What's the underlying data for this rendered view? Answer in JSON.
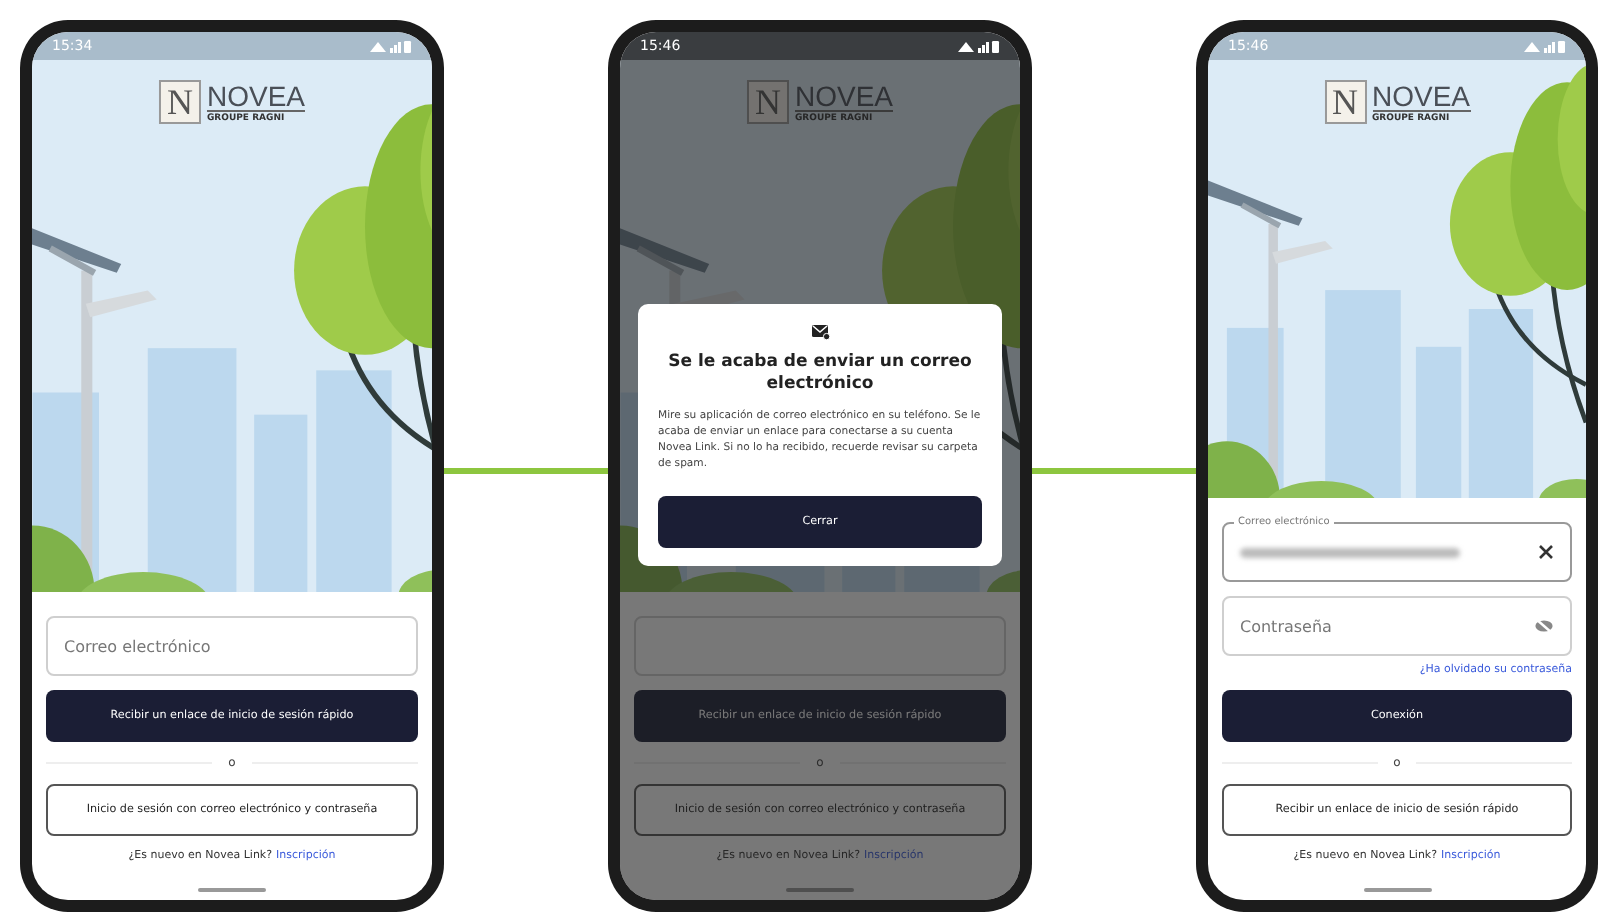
{
  "screens": [
    {
      "kind": "quick_link",
      "time": "15:34",
      "logo": {
        "mark": "N",
        "name": "NOVEA",
        "group": "GROUPE RAGNI"
      },
      "email_field": {
        "placeholder": "Correo electrónico"
      },
      "primary_button": "Recibir un enlace de inicio de sesión rápido",
      "separator": "o",
      "secondary_button": "Inicio de sesión con correo electrónico y contraseña",
      "signup": {
        "prompt": "¿Es nuevo en Novea Link?",
        "link": "Inscripción"
      }
    },
    {
      "kind": "quick_link",
      "time": "15:46",
      "logo": {
        "mark": "N",
        "name": "NOVEA",
        "group": "GROUPE RAGNI"
      },
      "primary_button": "Recibir un enlace de inicio de sesión rápido",
      "separator": "o",
      "secondary_button": "Inicio de sesión con correo electrónico y contraseña",
      "signup": {
        "prompt": "¿Es nuevo en Novea Link?",
        "link": "Inscripción"
      },
      "dialog": {
        "title": "Se le acaba de enviar un correo electrónico",
        "body": "Mire su aplicación de correo electrónico en su teléfono. Se le acaba de enviar un enlace para conectarse a su cuenta Novea Link. Si no lo ha recibido, recuerde revisar su carpeta de spam.",
        "button": "Cerrar"
      }
    },
    {
      "kind": "password",
      "time": "15:46",
      "logo": {
        "mark": "N",
        "name": "NOVEA",
        "group": "GROUPE RAGNI"
      },
      "email_field": {
        "label": "Correo electrónico"
      },
      "password_field": {
        "placeholder": "Contraseña"
      },
      "forgot_link": "¿Ha olvidado su contraseña",
      "primary_button": "Conexión",
      "separator": "o",
      "secondary_button": "Recibir un enlace de inicio de sesión rápido",
      "signup": {
        "prompt": "¿Es nuevo en Novea Link?",
        "link": "Inscripción"
      }
    }
  ]
}
